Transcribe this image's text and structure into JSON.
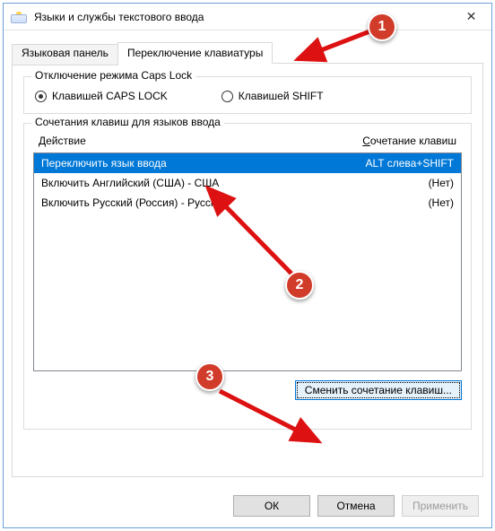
{
  "window": {
    "title": "Языки и службы текстового ввода",
    "close_glyph": "✕"
  },
  "tabs": {
    "items": [
      {
        "label": "Языковая панель",
        "active": false
      },
      {
        "label": "Переключение клавиатуры",
        "active": true
      }
    ]
  },
  "capslock_group": {
    "legend": "Отключение режима Caps Lock",
    "options": [
      {
        "label": "Клавишей CAPS LOCK",
        "selected": true
      },
      {
        "label": "Клавишей SHIFT",
        "selected": false
      }
    ]
  },
  "hotkeys_group": {
    "legend": "Сочетания клавиш для языков ввода",
    "columns": {
      "action": "Действие",
      "combo_pre": "С",
      "combo_rest": "очетание клавиш"
    },
    "rows": [
      {
        "action": "Переключить язык ввода",
        "combo": "ALT слева+SHIFT",
        "selected": true
      },
      {
        "action": "Включить Английский (США) - США",
        "combo": "(Нет)",
        "selected": false
      },
      {
        "action": "Включить Русский (Россия) - Русская",
        "combo": "(Нет)",
        "selected": false
      }
    ],
    "change_button": "Сменить сочетание клавиш..."
  },
  "buttons": {
    "ok": "ОК",
    "cancel": "Отмена",
    "apply": "Применить"
  },
  "annotations": {
    "b1": "1",
    "b2": "2",
    "b3": "3"
  }
}
